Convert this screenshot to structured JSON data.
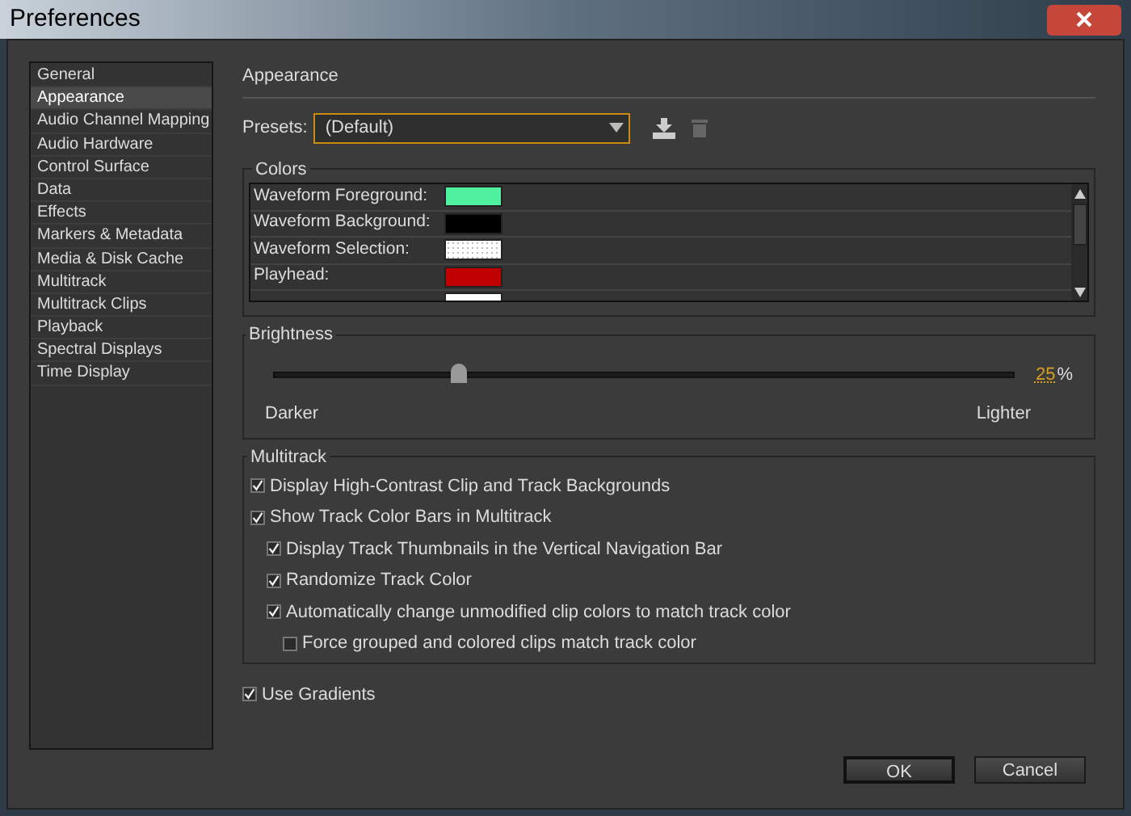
{
  "window": {
    "title": "Preferences"
  },
  "sidebar": {
    "items": [
      {
        "label": "General",
        "selected": false
      },
      {
        "label": "Appearance",
        "selected": true
      },
      {
        "label": "Audio Channel Mapping",
        "selected": false
      },
      {
        "label": "Audio Hardware",
        "selected": false
      },
      {
        "label": "Control Surface",
        "selected": false
      },
      {
        "label": "Data",
        "selected": false
      },
      {
        "label": "Effects",
        "selected": false
      },
      {
        "label": "Markers & Metadata",
        "selected": false
      },
      {
        "label": "Media & Disk Cache",
        "selected": false
      },
      {
        "label": "Multitrack",
        "selected": false
      },
      {
        "label": "Multitrack Clips",
        "selected": false
      },
      {
        "label": "Playback",
        "selected": false
      },
      {
        "label": "Spectral Displays",
        "selected": false
      },
      {
        "label": "Time Display",
        "selected": false
      }
    ]
  },
  "page_title": "Appearance",
  "presets": {
    "label": "Presets:",
    "value": "(Default)"
  },
  "colors": {
    "title": "Colors",
    "rows": [
      {
        "label": "Waveform Foreground:",
        "color": "#4ff0a0",
        "kind": "solid"
      },
      {
        "label": "Waveform Background:",
        "color": "#000000",
        "kind": "solid"
      },
      {
        "label": "Waveform Selection:",
        "color": "#ffffff",
        "kind": "dotted"
      },
      {
        "label": "Playhead:",
        "color": "#c00000",
        "kind": "solid"
      },
      {
        "color": "#ffffff",
        "kind": "solid"
      }
    ]
  },
  "brightness": {
    "title": "Brightness",
    "level": 0.25,
    "value": "25",
    "unit": "%",
    "min_label": "Darker",
    "max_label": "Lighter"
  },
  "multitrack": {
    "title": "Multitrack",
    "options": [
      {
        "label": "Display High-Contrast Clip and Track Backgrounds",
        "checked": true
      },
      {
        "label": "Show Track Color Bars in Multitrack",
        "checked": true,
        "children": [
          {
            "label": "Display Track Thumbnails in the Vertical Navigation Bar",
            "checked": true
          },
          {
            "label": "Randomize Track Color",
            "checked": true
          },
          {
            "label": "Automatically change unmodified clip colors to match track color",
            "checked": true,
            "children": [
              {
                "label": "Force grouped and colored clips match track color",
                "checked": false
              }
            ]
          }
        ]
      }
    ]
  },
  "use_gradients": {
    "label": "Use Gradients",
    "checked": true
  },
  "buttons": [
    {
      "label": "OK",
      "kind": "default"
    },
    {
      "label": "Cancel",
      "kind": "normal"
    }
  ]
}
